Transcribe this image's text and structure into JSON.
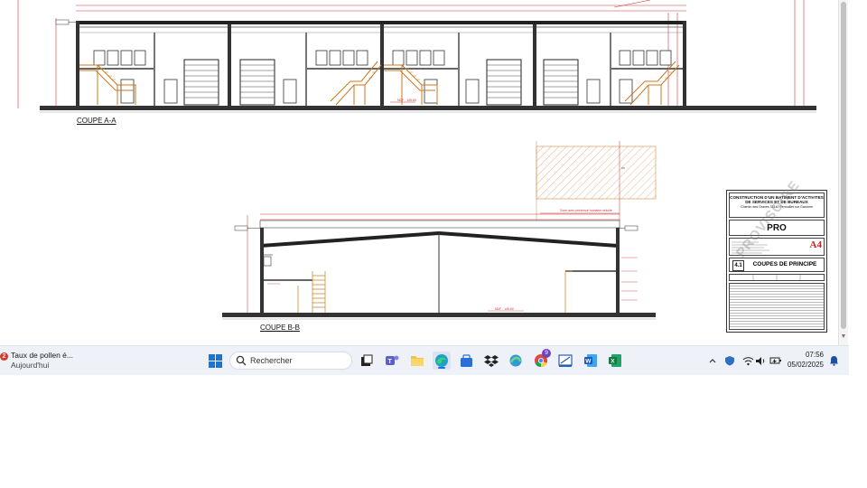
{
  "drawing": {
    "section_a_label": "COUPE A-A",
    "section_b_label": "COUPE B-B",
    "zone_note": "Zone avec présence humaine réduite",
    "level_b": "NDF : 145.60",
    "level_a": "NDF : 145.60"
  },
  "title_block": {
    "project_title": "CONSTRUCTION D'UN BATIMENT D'ACTIVITES DE SERVICES ET DE BUREAUX",
    "project_address": "Chemin des Graves 31140 Fenouillet sur Garonne",
    "phase": "PRO",
    "logo": "A4",
    "sheet_number": "4.1",
    "sheet_title": "COUPES DE PRINCIPE",
    "watermark": "PROVISOIRE"
  },
  "taskbar": {
    "widget_badge": "2",
    "widget_title": "Taux de pollen é...",
    "widget_subtitle": "Aujourd'hui",
    "search_placeholder": "Rechercher",
    "chrome_badge": "9",
    "time": "07:56",
    "date": "05/02/2025",
    "apps": [
      "windows-start",
      "search",
      "task-view",
      "teams",
      "file-explorer",
      "edge",
      "store",
      "dropbox",
      "browser",
      "chrome",
      "snipping",
      "word",
      "excel"
    ],
    "tray": [
      "show-hidden-chevron",
      "security",
      "wifi",
      "volume",
      "battery",
      "notifications"
    ]
  }
}
